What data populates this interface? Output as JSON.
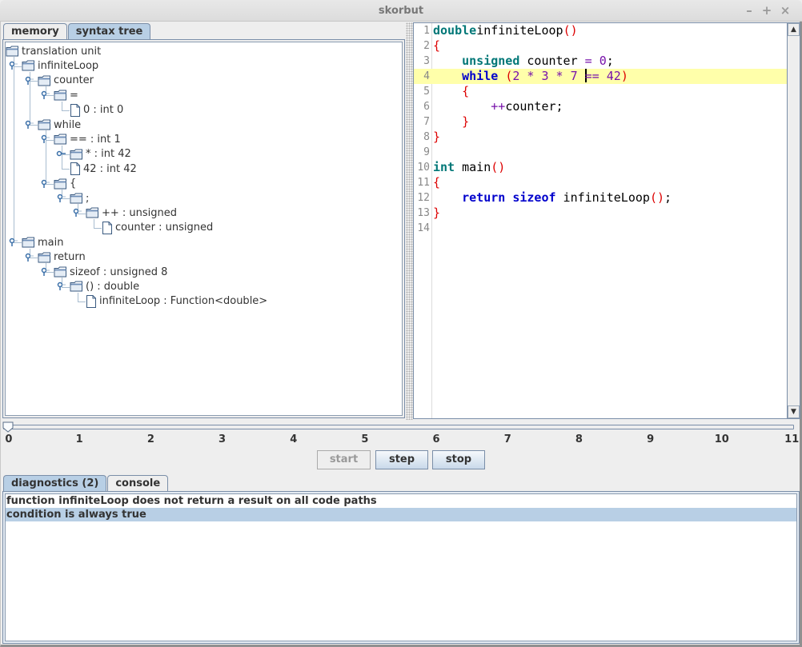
{
  "window": {
    "title": "skorbut",
    "controls": {
      "minimize": "–",
      "maximize": "+",
      "close": "×"
    }
  },
  "left_tabs": [
    {
      "label": "memory",
      "active": false
    },
    {
      "label": "syntax tree",
      "active": true
    }
  ],
  "syntax_tree": [
    {
      "label": "translation unit",
      "depth": 0,
      "kind": "folder",
      "expanded": false
    },
    {
      "label": "infiniteLoop",
      "depth": 1,
      "kind": "folder",
      "expanded": true
    },
    {
      "label": "counter",
      "depth": 2,
      "kind": "folder",
      "expanded": true
    },
    {
      "label": "=",
      "depth": 3,
      "kind": "folder",
      "expanded": true
    },
    {
      "label": "0 : int 0",
      "depth": 4,
      "kind": "file"
    },
    {
      "label": "while",
      "depth": 2,
      "kind": "folder",
      "expanded": true
    },
    {
      "label": "== : int 1",
      "depth": 3,
      "kind": "folder",
      "expanded": true
    },
    {
      "label": "* : int 42",
      "depth": 4,
      "kind": "folder",
      "expanded": false
    },
    {
      "label": "42 : int 42",
      "depth": 4,
      "kind": "file"
    },
    {
      "label": "{",
      "depth": 3,
      "kind": "folder",
      "expanded": true
    },
    {
      "label": ";",
      "depth": 4,
      "kind": "folder",
      "expanded": true
    },
    {
      "label": "++ : unsigned",
      "depth": 5,
      "kind": "folder",
      "expanded": true
    },
    {
      "label": "counter : unsigned",
      "depth": 6,
      "kind": "file"
    },
    {
      "label": "main",
      "depth": 1,
      "kind": "folder",
      "expanded": true
    },
    {
      "label": "return",
      "depth": 2,
      "kind": "folder",
      "expanded": true
    },
    {
      "label": "sizeof : unsigned 8",
      "depth": 3,
      "kind": "folder",
      "expanded": true
    },
    {
      "label": "() : double",
      "depth": 4,
      "kind": "folder",
      "expanded": true
    },
    {
      "label": "infiniteLoop : Function<double>",
      "depth": 5,
      "kind": "file"
    }
  ],
  "editor": {
    "highlighted_line": 4,
    "lines": [
      {
        "n": "1",
        "tokens": [
          [
            "kw-type",
            "double"
          ],
          [
            "",
            "infiniteLoop"
          ],
          [
            "paren",
            "()"
          ]
        ]
      },
      {
        "n": "2",
        "tokens": [
          [
            "paren",
            "{"
          ]
        ]
      },
      {
        "n": "3",
        "tokens": [
          [
            "",
            "    "
          ],
          [
            "kw-type",
            "unsigned"
          ],
          [
            "",
            " counter "
          ],
          [
            "op",
            "="
          ],
          [
            "",
            " "
          ],
          [
            "num",
            "0"
          ],
          [
            "",
            ";"
          ]
        ]
      },
      {
        "n": "4",
        "tokens": [
          [
            "",
            "    "
          ],
          [
            "kw",
            "while"
          ],
          [
            "",
            " "
          ],
          [
            "paren",
            "("
          ],
          [
            "num",
            "2"
          ],
          [
            "",
            " "
          ],
          [
            "op",
            "*"
          ],
          [
            "",
            " "
          ],
          [
            "num",
            "3"
          ],
          [
            "",
            " "
          ],
          [
            "op",
            "*"
          ],
          [
            "",
            " "
          ],
          [
            "num",
            "7"
          ],
          [
            "",
            " "
          ],
          [
            "caret",
            ""
          ],
          [
            "op",
            "=="
          ],
          [
            "",
            " "
          ],
          [
            "num",
            "42"
          ],
          [
            "paren",
            ")"
          ]
        ]
      },
      {
        "n": "5",
        "tokens": [
          [
            "",
            "    "
          ],
          [
            "paren",
            "{"
          ]
        ]
      },
      {
        "n": "6",
        "tokens": [
          [
            "",
            "        "
          ],
          [
            "op",
            "++"
          ],
          [
            "",
            "counter;"
          ]
        ]
      },
      {
        "n": "7",
        "tokens": [
          [
            "",
            "    "
          ],
          [
            "paren",
            "}"
          ]
        ]
      },
      {
        "n": "8",
        "tokens": [
          [
            "paren",
            "}"
          ]
        ]
      },
      {
        "n": "9",
        "tokens": []
      },
      {
        "n": "10",
        "tokens": [
          [
            "kw-type",
            "int"
          ],
          [
            "",
            " main"
          ],
          [
            "paren",
            "()"
          ]
        ]
      },
      {
        "n": "11",
        "tokens": [
          [
            "paren",
            "{"
          ]
        ]
      },
      {
        "n": "12",
        "tokens": [
          [
            "",
            "    "
          ],
          [
            "kw",
            "return"
          ],
          [
            "",
            " "
          ],
          [
            "kw",
            "sizeof"
          ],
          [
            "",
            " infiniteLoop"
          ],
          [
            "paren",
            "()"
          ],
          [
            "",
            ";"
          ]
        ]
      },
      {
        "n": "13",
        "tokens": [
          [
            "paren",
            "}"
          ]
        ]
      },
      {
        "n": "14",
        "tokens": []
      }
    ]
  },
  "timeline": {
    "min": 0,
    "max": 11,
    "value": 0,
    "ticks": [
      "0",
      "1",
      "2",
      "3",
      "4",
      "5",
      "6",
      "7",
      "8",
      "9",
      "10",
      "11"
    ]
  },
  "controls": {
    "start": {
      "label": "start",
      "enabled": false
    },
    "step": {
      "label": "step",
      "enabled": true
    },
    "stop": {
      "label": "stop",
      "enabled": true
    }
  },
  "bottom_tabs": [
    {
      "label": "diagnostics (2)",
      "active": true
    },
    {
      "label": "console",
      "active": false
    }
  ],
  "diagnostics": [
    {
      "text": "function infiniteLoop does not return a result on all code paths",
      "selected": false
    },
    {
      "text": "condition is always true",
      "selected": true
    }
  ],
  "colors": {
    "selection": "#b8cfe5",
    "current_line": "#ffffaa",
    "type_keyword": "#007777",
    "keyword": "#0000cc",
    "paren": "#dd0000",
    "number": "#7711aa"
  }
}
